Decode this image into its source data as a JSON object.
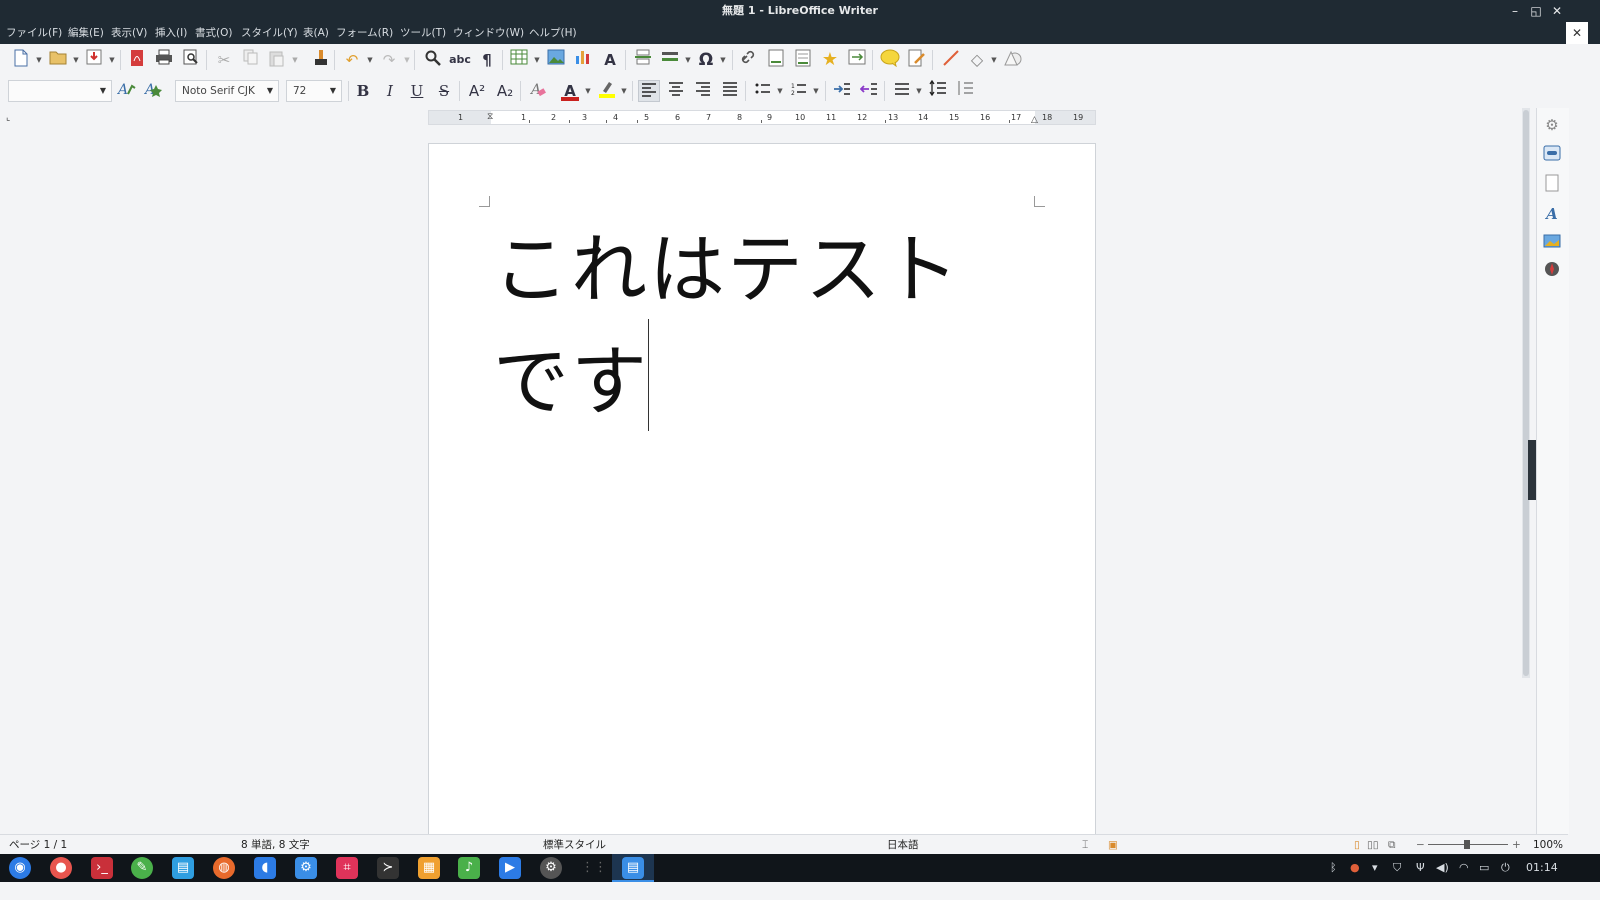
{
  "window": {
    "title": "無題 1 - LibreOffice Writer",
    "controls": {
      "minimize": "–",
      "maximize": "◱",
      "close": "✕"
    }
  },
  "menu": {
    "items": [
      "ファイル(F)",
      "編集(E)",
      "表示(V)",
      "挿入(I)",
      "書式(O)",
      "スタイル(Y)",
      "表(A)",
      "フォーム(R)",
      "ツール(T)",
      "ウィンドウ(W)",
      "ヘルプ(H)"
    ],
    "close_doc": "✕"
  },
  "toolbar1": {
    "icons": [
      "new-document-icon",
      "open-icon",
      "save-icon",
      "export-pdf-icon",
      "print-icon",
      "print-preview-icon",
      "cut-icon",
      "copy-icon",
      "paste-icon",
      "clone-formatting-icon",
      "undo-icon",
      "redo-icon",
      "find-replace-icon",
      "spelling-icon",
      "formatting-marks-icon",
      "insert-table-icon",
      "insert-image-icon",
      "insert-chart-icon",
      "insert-textbox-icon",
      "page-break-icon",
      "insert-field-icon",
      "special-character-icon",
      "hyperlink-icon",
      "footnote-icon",
      "endnote-icon",
      "bookmark-icon",
      "cross-reference-icon",
      "comment-icon",
      "track-changes-icon",
      "line-icon",
      "basic-shapes-icon",
      "draw-functions-icon"
    ],
    "glyphs": {
      "abc": "abc",
      "pilcrow": "¶",
      "omega": "Ω",
      "text_a": "A"
    }
  },
  "toolbar2": {
    "paragraph_style": "",
    "font_name": "Noto Serif CJK",
    "font_size": "72",
    "glyphs": {
      "bold": "B",
      "italic": "I",
      "underline": "U",
      "strike": "S",
      "superscript": "A²",
      "subscript": "A₂",
      "font_color": "A"
    },
    "colors": {
      "font_color": "#c9211e",
      "highlight": "#ffff00"
    }
  },
  "ruler": {
    "numbers": [
      "1",
      "1",
      "2",
      "3",
      "4",
      "5",
      "6",
      "7",
      "8",
      "9",
      "10",
      "11",
      "12",
      "13",
      "14",
      "15",
      "16",
      "17",
      "18",
      "19"
    ]
  },
  "document": {
    "lines": [
      "これはテスト",
      "です"
    ]
  },
  "status": {
    "page": "ページ 1 / 1",
    "words": "8 単語, 8 文字",
    "style": "標準スタイル",
    "language": "日本語",
    "zoom": "100%"
  },
  "taskbar": {
    "clock": "01:14"
  }
}
